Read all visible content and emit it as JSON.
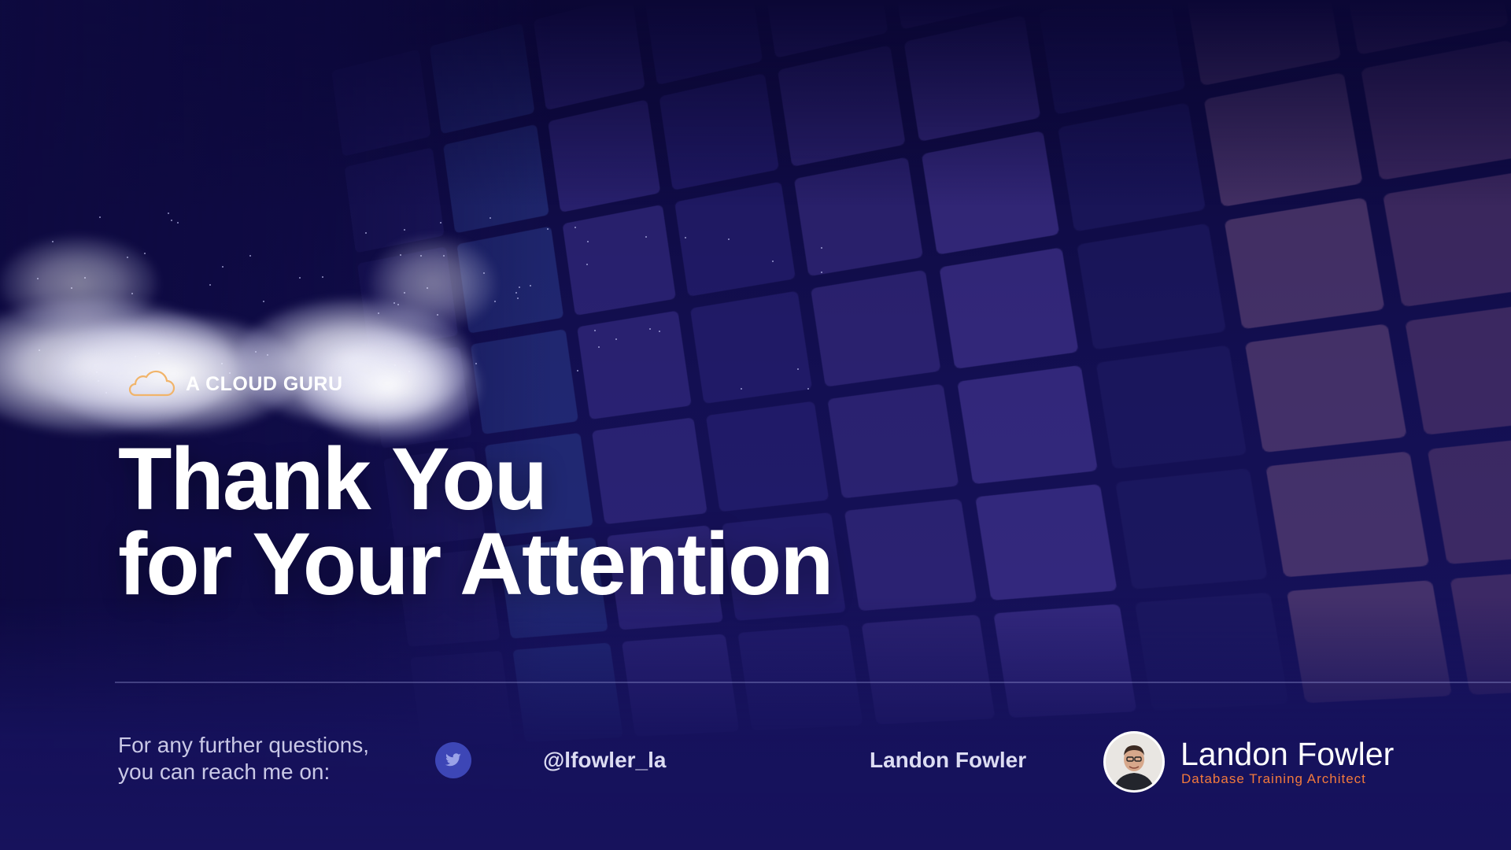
{
  "brand": {
    "name": "A CLOUD GURU",
    "icon": "cloud-outline-icon"
  },
  "headline": {
    "line1": "Thank You",
    "line2": "for Your Attention"
  },
  "contact": {
    "line1": "For any further questions,",
    "line2": "you can reach me on:",
    "twitter_icon": "twitter-bird-icon",
    "handle": "@lfowler_la",
    "name": "Landon Fowler"
  },
  "presenter": {
    "name": "Landon Fowler",
    "title": "Database Training Architect",
    "avatar": "presenter-avatar"
  },
  "colors": {
    "background": "#130f52",
    "accent": "#f27a3c",
    "twitter_button": "#3d46b6",
    "text": "#ffffff"
  }
}
